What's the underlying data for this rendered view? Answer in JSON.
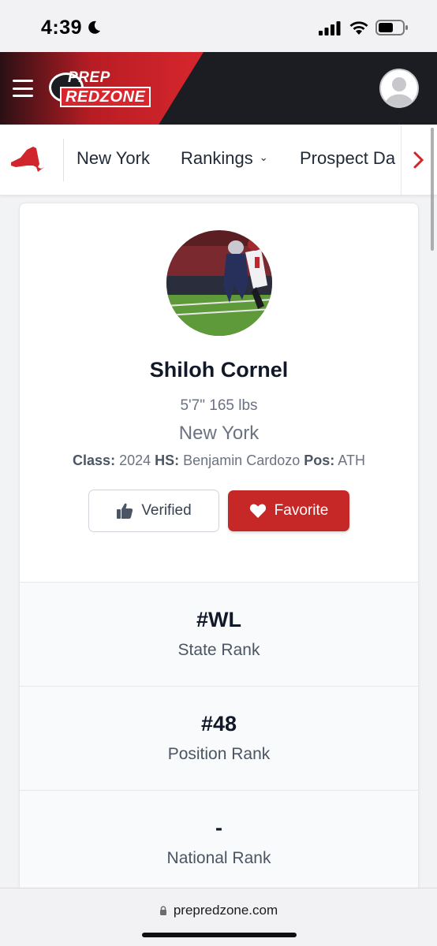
{
  "status_bar": {
    "time": "4:39"
  },
  "header": {
    "logo_line1": "PREP",
    "logo_line2": "REDZONE"
  },
  "subnav": {
    "items": [
      {
        "label": "New York"
      },
      {
        "label": "Rankings"
      },
      {
        "label": "Prospect Da"
      }
    ]
  },
  "profile": {
    "name": "Shiloh Cornel",
    "measurements": "5'7\" 165 lbs",
    "state": "New York",
    "class_label": "Class:",
    "class_value": "2024",
    "hs_label": "HS:",
    "hs_value": "Benjamin Cardozo",
    "pos_label": "Pos:",
    "pos_value": "ATH",
    "verified_label": "Verified",
    "favorite_label": "Favorite"
  },
  "ranks": [
    {
      "value": "#WL",
      "label": "State Rank"
    },
    {
      "value": "#48",
      "label": "Position Rank"
    },
    {
      "value": "-",
      "label": "National Rank"
    }
  ],
  "browser": {
    "url": "prepredzone.com"
  },
  "colors": {
    "brand_red": "#c62828",
    "header_dark": "#1c1d22"
  }
}
